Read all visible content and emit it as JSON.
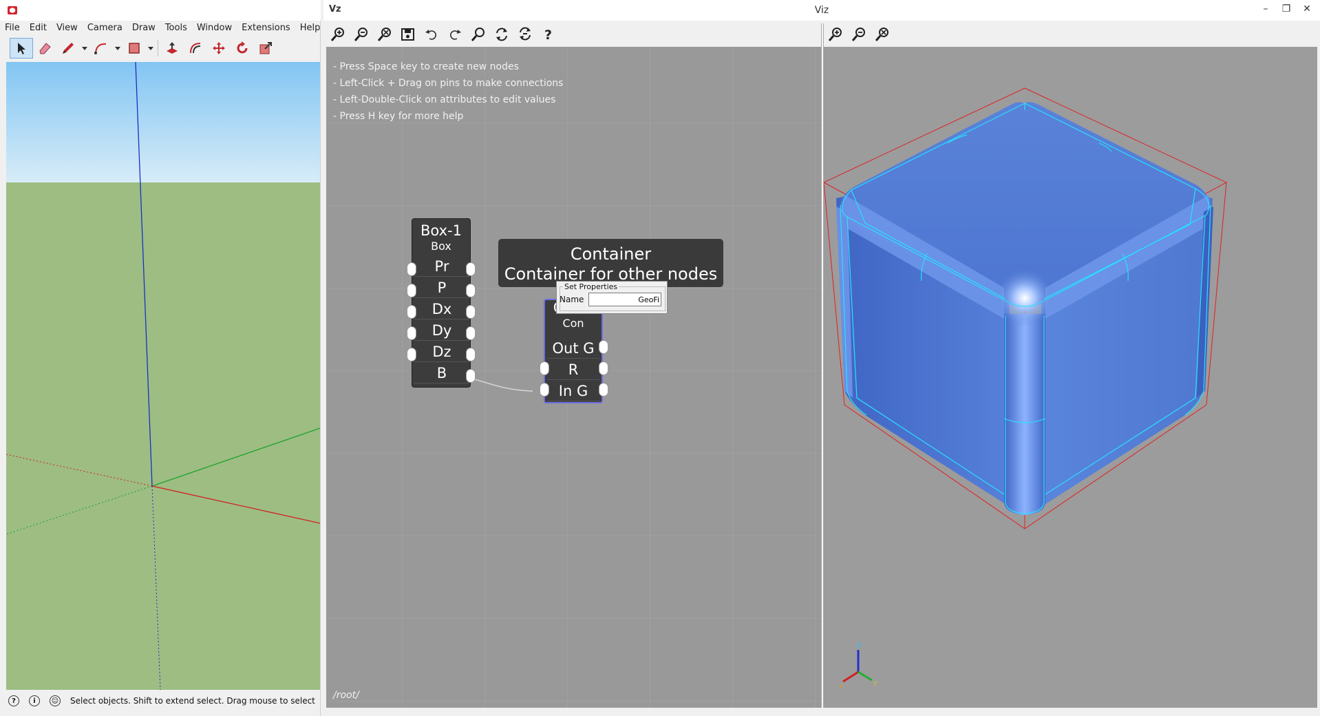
{
  "sketchup": {
    "menu": [
      "File",
      "Edit",
      "View",
      "Camera",
      "Draw",
      "Tools",
      "Window",
      "Extensions",
      "Help"
    ],
    "toolbar": [
      {
        "name": "select-tool",
        "icon": "arrow-cursor-icon",
        "selected": true
      },
      {
        "name": "eraser-tool",
        "icon": "eraser-icon"
      },
      {
        "name": "pencil-tool",
        "icon": "pencil-icon"
      },
      {
        "name": "pencil-dropdown",
        "icon": "chevron-down-icon"
      },
      {
        "name": "arc-tool",
        "icon": "arc-icon"
      },
      {
        "name": "arc-dropdown",
        "icon": "chevron-down-icon"
      },
      {
        "name": "rectangle-tool",
        "icon": "rectangle-icon"
      },
      {
        "name": "rectangle-dropdown",
        "icon": "chevron-down-icon"
      },
      {
        "name": "push-pull-tool",
        "icon": "push-pull-icon"
      },
      {
        "name": "offset-tool",
        "icon": "offset-icon"
      },
      {
        "name": "move-tool",
        "icon": "move-icon"
      },
      {
        "name": "rotate-tool",
        "icon": "rotate-icon"
      },
      {
        "name": "scale-tool",
        "icon": "scale-icon"
      }
    ],
    "status_text": "Select objects. Shift to extend select. Drag mouse to select m",
    "colors": {
      "sky": "#82c5f3",
      "ground": "#9dbd83",
      "blue_axis": "#1a2fc4",
      "red_axis": "#d42020",
      "green_axis": "#1aa32c"
    }
  },
  "viz": {
    "logo": "Vz",
    "title": "Viz",
    "window_buttons": [
      "–",
      "❐",
      "✕"
    ],
    "graph_toolbar": [
      "zoom-in-icon",
      "zoom-out-icon",
      "zoom-reset-icon",
      "save-icon",
      "undo-icon",
      "redo-icon",
      "search-icon",
      "refresh-icon",
      "refresh-all-icon",
      "help-icon"
    ],
    "view_toolbar": [
      "zoom-in-icon",
      "zoom-out-icon",
      "zoom-reset-icon"
    ],
    "help_lines": [
      "- Press Space key to create new nodes",
      "- Left-Click + Drag on pins to make connections",
      "- Left-Double-Click on attributes to edit values",
      "- Press H key for more help"
    ],
    "root_path": "/root/",
    "box_node": {
      "title": "Box-1",
      "type": "Box",
      "pins": [
        "Pr",
        "P",
        "Dx",
        "Dy",
        "Dz",
        "B"
      ]
    },
    "container_node": {
      "title": "GeoFi",
      "type": "Con",
      "pins": [
        "Out G",
        "R",
        "In G"
      ]
    },
    "tooltip": {
      "title": "Container",
      "description": "Container for other nodes"
    },
    "set_properties": {
      "legend": "Set Properties",
      "name_label": "Name",
      "name_value": "GeoFi"
    },
    "viewport": {
      "cube_color": "#5b86dc",
      "edge_color": "#29e0ff",
      "bbox_color": "#e02020",
      "axis_labels": [
        "Z",
        "X",
        "Y"
      ]
    }
  }
}
